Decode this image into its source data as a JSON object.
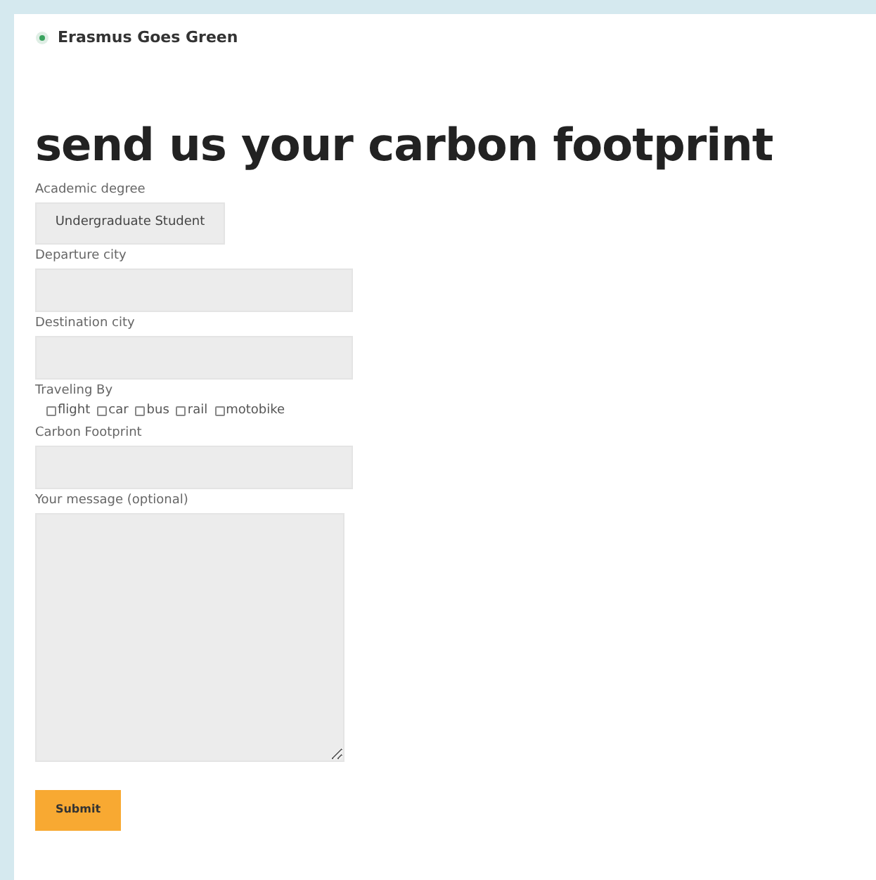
{
  "site": {
    "name": "Erasmus Goes Green"
  },
  "heading": "send us your carbon footprint",
  "form": {
    "degree": {
      "label": "Academic degree",
      "value": "Undergraduate Student"
    },
    "departure": {
      "label": "Departure city"
    },
    "destination": {
      "label": "Destination city"
    },
    "traveling": {
      "label": "Traveling By",
      "options": [
        {
          "label": "flight",
          "checked": false
        },
        {
          "label": "car",
          "checked": false
        },
        {
          "label": "bus",
          "checked": false
        },
        {
          "label": "rail",
          "checked": false
        },
        {
          "label": "motobike",
          "checked": false
        }
      ]
    },
    "footprint": {
      "label": "Carbon Footprint"
    },
    "message": {
      "label": "Your message (optional)"
    },
    "submit": "Submit"
  }
}
